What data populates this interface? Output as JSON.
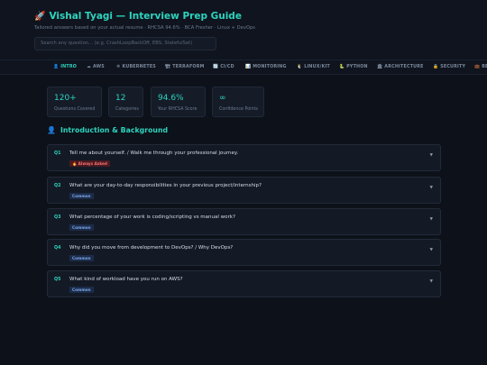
{
  "header": {
    "title": "Vishal Tyagi — Interview Prep Guide",
    "title_icon": "rocket-icon",
    "subtitle": "Tailored answers based on your actual resume · RHCSA 94.6% · BCA Fresher · Linux + DevOps",
    "search_placeholder": "Search any question... (e.g. CrashLoopBackOff, EBS, StatefulSet)"
  },
  "tabs": [
    {
      "icon": "👤",
      "label": "INTRO",
      "active": true
    },
    {
      "icon": "☁",
      "label": "AWS"
    },
    {
      "icon": "☸",
      "label": "KUBERNETES"
    },
    {
      "icon": "🏗",
      "label": "TERRAFORM"
    },
    {
      "icon": "🔄",
      "label": "CI/CD"
    },
    {
      "icon": "📊",
      "label": "MONITORING"
    },
    {
      "icon": "🐧",
      "label": "LINUX/KIT"
    },
    {
      "icon": "🐍",
      "label": "PYTHON"
    },
    {
      "icon": "🏛",
      "label": "ARCHITECTURE"
    },
    {
      "icon": "🔒",
      "label": "SECURITY"
    },
    {
      "icon": "💼",
      "label": "BE"
    }
  ],
  "stats": [
    {
      "value": "120+",
      "label": "Questions Covered"
    },
    {
      "value": "12",
      "label": "Categories"
    },
    {
      "value": "94.6%",
      "label": "Your RHCSA Score"
    },
    {
      "value": "∞",
      "label": "Confidence Points"
    }
  ],
  "section": {
    "icon": "person-icon",
    "title": "Introduction & Background"
  },
  "questions": [
    {
      "id": "Q1",
      "text": "Tell me about yourself. / Walk me through your professional journey.",
      "tag": "🔥 Always Asked",
      "tag_type": "hot"
    },
    {
      "id": "Q2",
      "text": "What are your day-to-day responsibilities in your previous project/internship?",
      "tag": "Common",
      "tag_type": "common"
    },
    {
      "id": "Q3",
      "text": "What percentage of your work is coding/scripting vs manual work?",
      "tag": "Common",
      "tag_type": "common"
    },
    {
      "id": "Q4",
      "text": "Why did you move from development to DevOps? / Why DevOps?",
      "tag": "Common",
      "tag_type": "common"
    },
    {
      "id": "Q5",
      "text": "What kind of workload have you run on AWS?",
      "tag": "Common",
      "tag_type": "common"
    }
  ],
  "colors": {
    "accent": "#2dd4bf",
    "background": "#0d1119",
    "hot_tag": "#f87171",
    "common_tag": "#7fa6e6"
  }
}
